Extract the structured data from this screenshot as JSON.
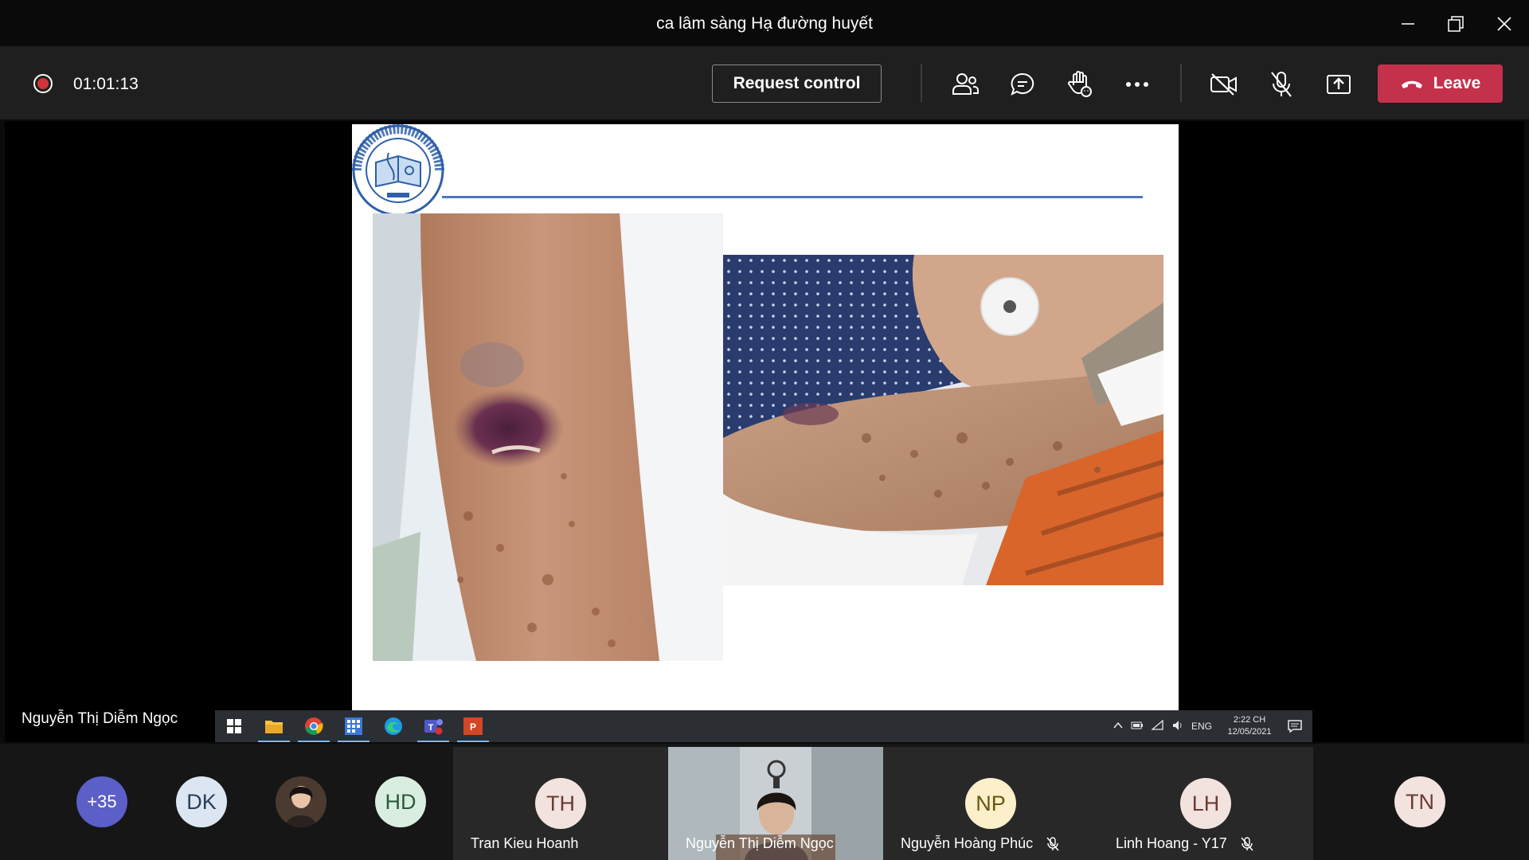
{
  "window": {
    "title": "ca lâm sàng Hạ đường huyết"
  },
  "toolbar": {
    "recording_time": "01:01:13",
    "request_control_label": "Request control",
    "leave_label": "Leave"
  },
  "shared_screen": {
    "presenter_name": "Nguyễn Thị Diễm Ngọc",
    "taskbar": {
      "language": "ENG",
      "time": "2:22 CH",
      "date": "12/05/2021"
    }
  },
  "participants": {
    "overflow_count": "+35",
    "avatars": [
      {
        "initials": "DK",
        "color": "#dce6f2",
        "text_color": "#2b3f5c"
      },
      {
        "initials": "HD",
        "color": "#d9eee1",
        "text_color": "#2d5a3c"
      }
    ],
    "tiles": [
      {
        "initials": "TH",
        "name": "Tran Kieu Hoanh",
        "color": "#f2e3df",
        "text_color": "#6b3c33",
        "muted": false
      },
      {
        "initials": "",
        "name": "Nguyễn Thị Diễm Ngọc",
        "muted": false,
        "video": true
      },
      {
        "initials": "NP",
        "name": "Nguyễn Hoàng Phúc",
        "color": "#fbf0c9",
        "text_color": "#6b5510",
        "muted": true
      },
      {
        "initials": "LH",
        "name": "Linh Hoang - Y17",
        "color": "#f2e3df",
        "text_color": "#6b3c33",
        "muted": true
      }
    ],
    "last_avatar": {
      "initials": "TN",
      "color": "#f2e3df",
      "text_color": "#6b3c33"
    }
  }
}
